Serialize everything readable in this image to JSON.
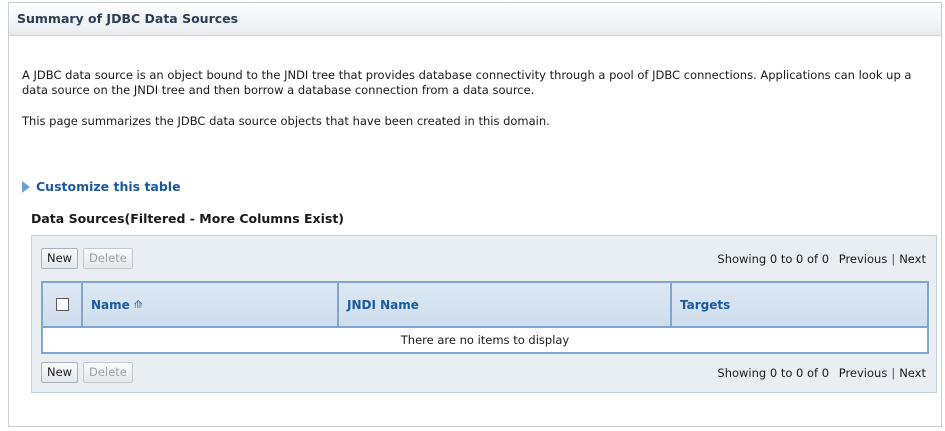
{
  "panel": {
    "title": "Summary of JDBC Data Sources",
    "description_1": "A JDBC data source is an object bound to the JNDI tree that provides database connectivity through a pool of JDBC connections. Applications can look up a data source on the JNDI tree and then borrow a database connection from a data source.",
    "description_2": "This page summarizes the JDBC data source objects that have been created in this domain.",
    "customize_label": "Customize this table"
  },
  "table": {
    "title": "Data Sources(Filtered - More Columns Exist)",
    "new_label": "New",
    "delete_label": "Delete",
    "showing": "Showing 0 to 0 of 0",
    "previous": "Previous",
    "next": "Next",
    "columns": [
      "Name",
      "JNDI Name",
      "Targets"
    ],
    "empty_message": "There are no items to display"
  }
}
